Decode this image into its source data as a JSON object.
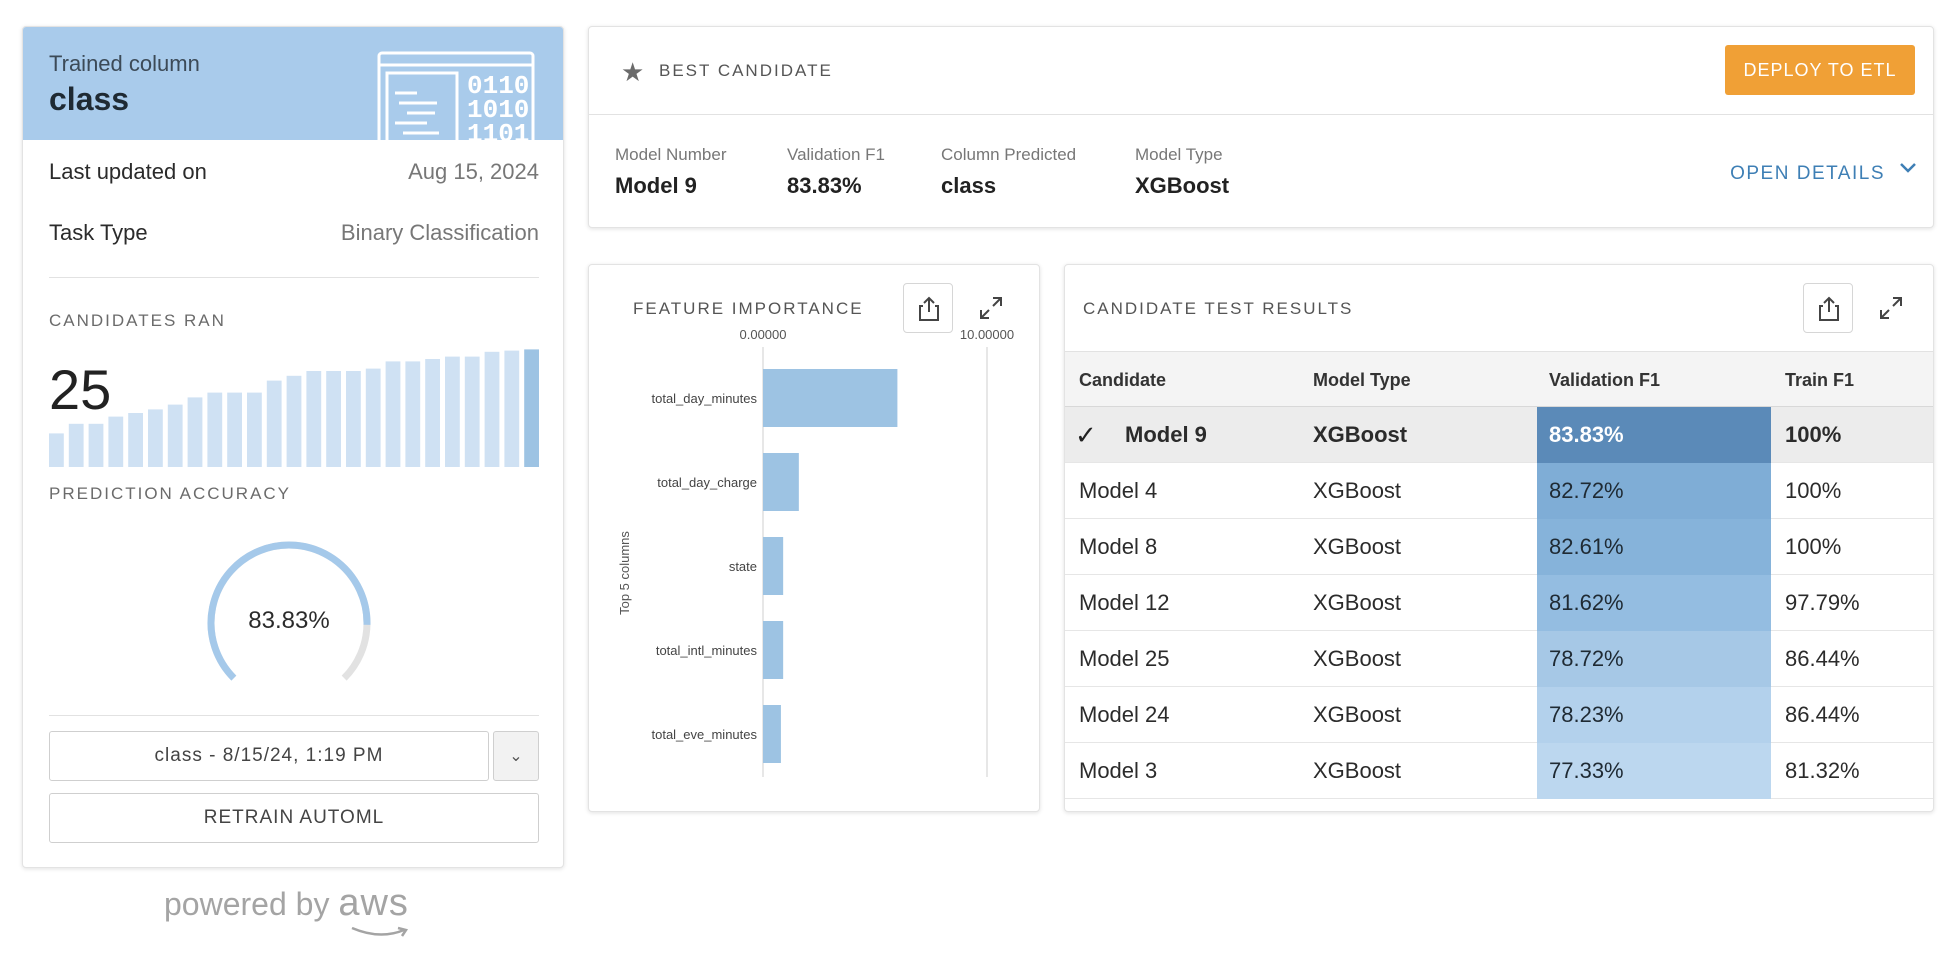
{
  "trained": {
    "subtitle": "Trained column",
    "title": "class",
    "last_updated_label": "Last updated on",
    "last_updated_value": "Aug 15, 2024",
    "task_type_label": "Task Type",
    "task_type_value": "Binary Classification",
    "candidates_ran_label": "CANDIDATES RAN",
    "candidates_ran_value": "25",
    "candidates_bars": [
      0.28,
      0.36,
      0.36,
      0.42,
      0.45,
      0.48,
      0.52,
      0.58,
      0.62,
      0.62,
      0.62,
      0.72,
      0.76,
      0.8,
      0.8,
      0.8,
      0.82,
      0.88,
      0.88,
      0.9,
      0.92,
      0.92,
      0.96,
      0.97,
      0.98
    ],
    "prediction_accuracy_label": "PREDICTION ACCURACY",
    "prediction_accuracy_value": "83.83%",
    "prediction_accuracy_fraction": 0.8383,
    "run_select_value": "class - 8/15/24, 1:19 PM",
    "retrain_label": "RETRAIN AUTOML",
    "powered_by": "powered by",
    "aws": "aws"
  },
  "best": {
    "title": "BEST CANDIDATE",
    "deploy_label": "DEPLOY TO ETL",
    "fields": [
      {
        "label": "Model Number",
        "value": "Model 9"
      },
      {
        "label": "Validation F1",
        "value": "83.83%"
      },
      {
        "label": "Column Predicted",
        "value": "class"
      },
      {
        "label": "Model Type",
        "value": "XGBoost"
      }
    ],
    "open_details_label": "OPEN DETAILS"
  },
  "feature_importance": {
    "title": "FEATURE IMPORTANCE"
  },
  "chart_data": {
    "type": "bar",
    "orientation": "horizontal",
    "categories": [
      "total_day_minutes",
      "total_day_charge",
      "state",
      "total_intl_minutes",
      "total_eve_minutes"
    ],
    "values": [
      6.0,
      1.6,
      0.9,
      0.9,
      0.8
    ],
    "xlim": [
      0,
      10
    ],
    "xticks": [
      "0.00000",
      "10.00000"
    ],
    "ylabel": "Top 5 columns",
    "color": "#9dc3e3"
  },
  "results": {
    "title": "CANDIDATE TEST RESULTS",
    "columns": [
      "Candidate",
      "Model Type",
      "Validation F1",
      "Train F1"
    ],
    "rows": [
      {
        "candidate": "Model 9",
        "model_type": "XGBoost",
        "validation_f1": "83.83%",
        "train_f1": "100%",
        "best": true,
        "shade": "#5b8ab8",
        "text_color": "#ffffff"
      },
      {
        "candidate": "Model 4",
        "model_type": "XGBoost",
        "validation_f1": "82.72%",
        "train_f1": "100%",
        "best": false,
        "shade": "#7fadd6",
        "text_color": "#1f2a33"
      },
      {
        "candidate": "Model 8",
        "model_type": "XGBoost",
        "validation_f1": "82.61%",
        "train_f1": "100%",
        "best": false,
        "shade": "#86b3da",
        "text_color": "#1f2a33"
      },
      {
        "candidate": "Model 12",
        "model_type": "XGBoost",
        "validation_f1": "81.62%",
        "train_f1": "97.79%",
        "best": false,
        "shade": "#94bde1",
        "text_color": "#1f2a33"
      },
      {
        "candidate": "Model 25",
        "model_type": "XGBoost",
        "validation_f1": "78.72%",
        "train_f1": "86.44%",
        "best": false,
        "shade": "#a6c8e6",
        "text_color": "#1f2a33"
      },
      {
        "candidate": "Model 24",
        "model_type": "XGBoost",
        "validation_f1": "78.23%",
        "train_f1": "86.44%",
        "best": false,
        "shade": "#b3d1ec",
        "text_color": "#1f2a33"
      },
      {
        "candidate": "Model 3",
        "model_type": "XGBoost",
        "validation_f1": "77.33%",
        "train_f1": "81.32%",
        "best": false,
        "shade": "#bcd7ef",
        "text_color": "#1f2a33"
      }
    ]
  }
}
